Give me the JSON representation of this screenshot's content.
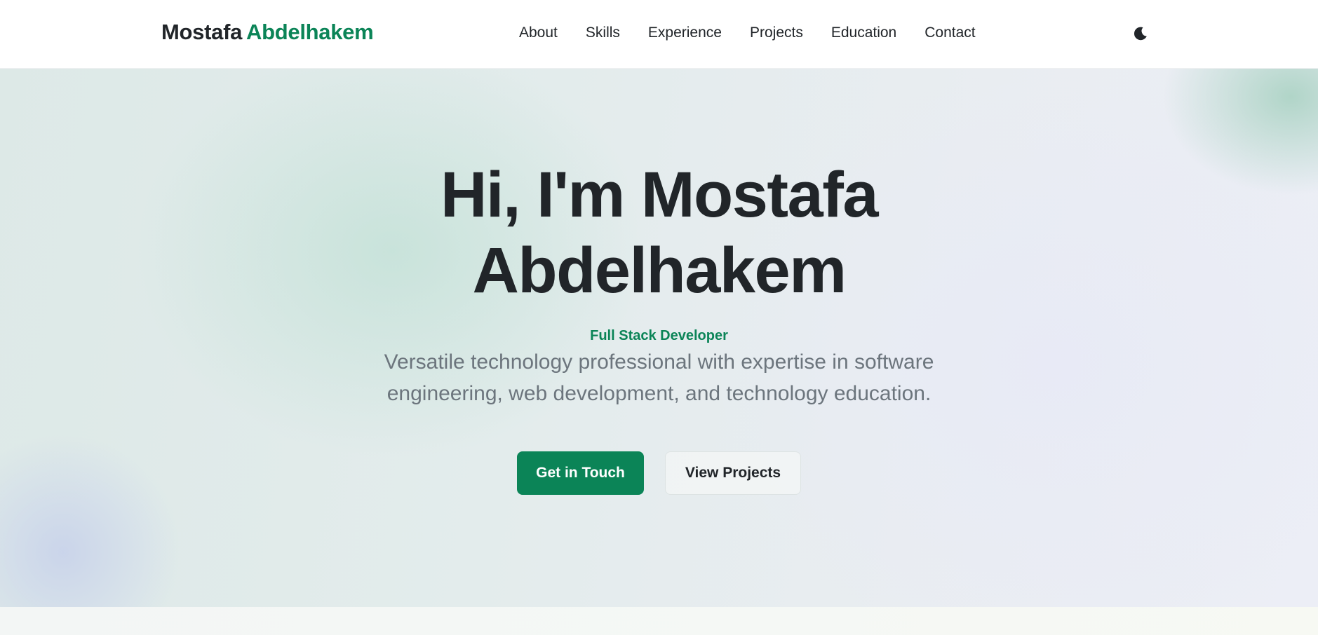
{
  "navbar": {
    "brand_first": "Mostafa",
    "brand_last": "Abdelhakem",
    "links": [
      "About",
      "Skills",
      "Experience",
      "Projects",
      "Education",
      "Contact"
    ],
    "theme_toggle_icon": "moon-icon"
  },
  "hero": {
    "title_line1": "Hi, I'm Mostafa",
    "title_line2": "Abdelhakem",
    "role": "Full Stack Developer",
    "description": "Versatile technology professional with expertise in software engineering, web development, and technology education.",
    "primary_button": "Get in Touch",
    "secondary_button": "View Projects"
  },
  "colors": {
    "accent": "#0b8457",
    "text_dark": "#212529",
    "text_muted": "#6c757d"
  }
}
